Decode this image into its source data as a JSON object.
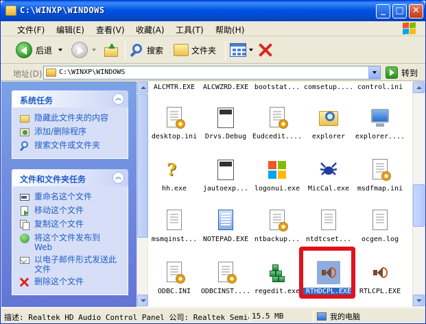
{
  "window": {
    "title": "C:\\WINXP\\WINDOWS",
    "min_label": "_",
    "max_label": "□",
    "close_label": "✕"
  },
  "menu": [
    {
      "label": "文件(F)"
    },
    {
      "label": "编辑(E)"
    },
    {
      "label": "查看(V)"
    },
    {
      "label": "收藏(A)"
    },
    {
      "label": "工具(T)"
    },
    {
      "label": "帮助(H)"
    }
  ],
  "toolbar": {
    "back_label": "后退",
    "search_label": "搜索",
    "folders_label": "文件夹"
  },
  "address": {
    "label": "地址(D)",
    "value": "C:\\WINXP\\WINDOWS",
    "go_label": "转到"
  },
  "system_tasks": {
    "title": "系统任务",
    "items": [
      {
        "label": "隐藏此文件夹的内容"
      },
      {
        "label": "添加/删除程序"
      },
      {
        "label": "搜索文件或文件夹"
      }
    ]
  },
  "file_tasks": {
    "title": "文件和文件夹任务",
    "items": [
      {
        "label": "重命名这个文件"
      },
      {
        "label": "移动这个文件"
      },
      {
        "label": "复制这个文件"
      },
      {
        "label": "将这个文件发布到 Web"
      },
      {
        "label": "以电子邮件形式发送此文件"
      },
      {
        "label": "删除这个文件"
      }
    ]
  },
  "files": {
    "row0": [
      "ALCMTR.EXE",
      "ALCWZRD.EXE",
      "bootstat...",
      "comsetup....",
      "control.ini"
    ],
    "row1": [
      "desktop.ini",
      "Drvs.Debug",
      "Eudcedit....",
      "explorer",
      "explorer...."
    ],
    "row2": [
      "hh.exe",
      "jautoexp...",
      "logonui.exe",
      "MicCal.exe",
      "msdfmap.ini"
    ],
    "row3": [
      "msmqinst...",
      "NOTEPAD.EXE",
      "ntbackup...",
      "ntdtcset...",
      "ocgen.log"
    ],
    "row4": [
      "ODBC.INI",
      "ODBCINST....",
      "regedit.exe",
      "RTHDCPL.EXE",
      "RTLCPL.EXE"
    ]
  },
  "status": {
    "description": "描述: Realtek HD Audio Control Panel 公司: Realtek Semiconductor",
    "size": "15.5 MB",
    "zone": "我的电脑"
  },
  "colors": {
    "titlebar": "#0054E3",
    "taskpane": "#6375D6",
    "selection": "#316AC5",
    "highlight_box": "#E0121E"
  }
}
